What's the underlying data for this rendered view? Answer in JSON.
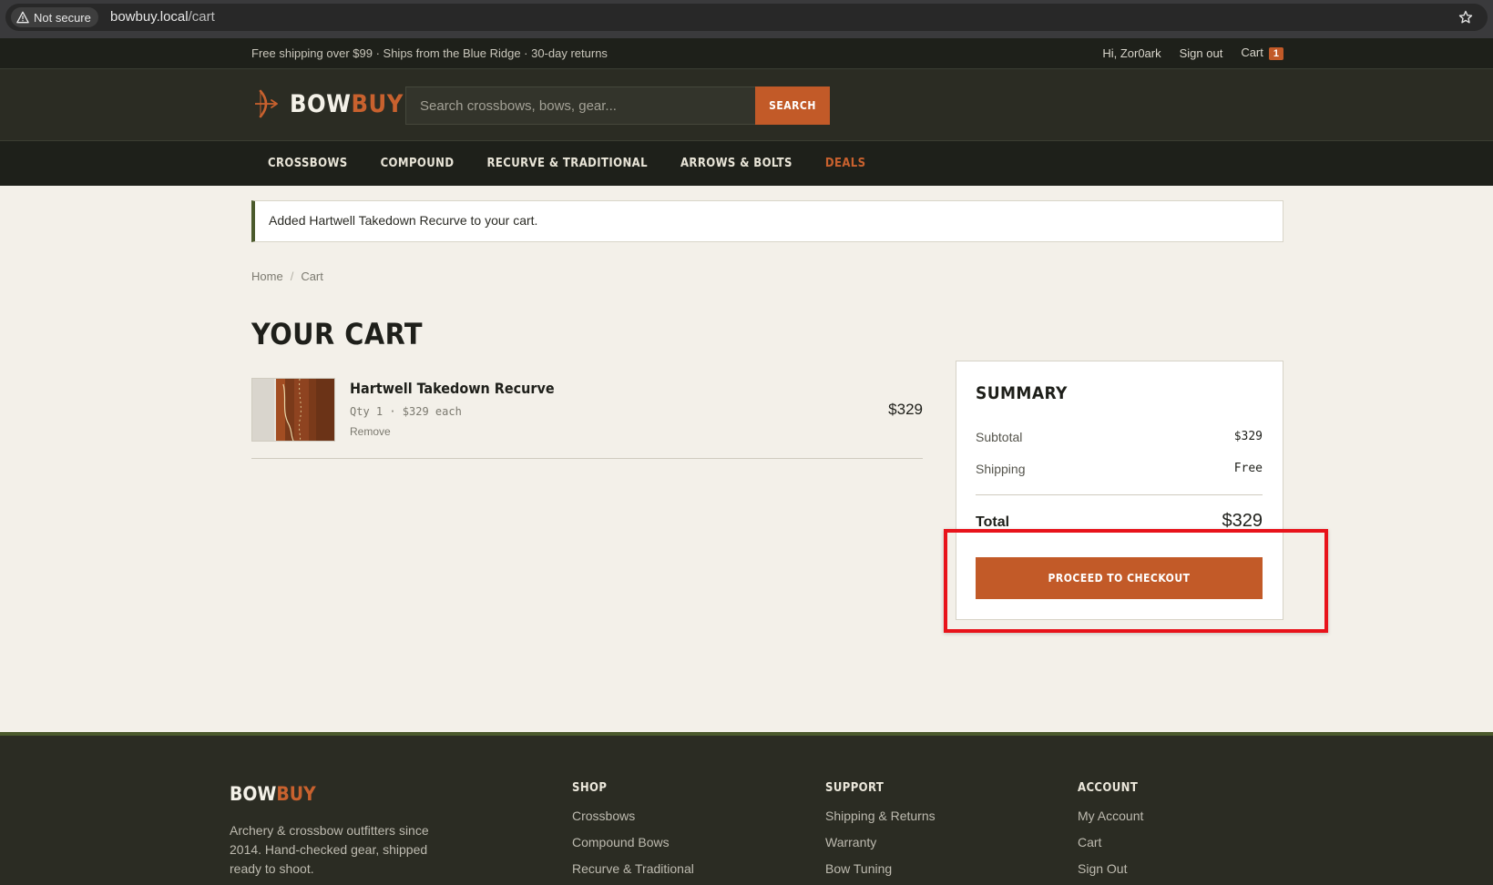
{
  "browser": {
    "security_label": "Not secure",
    "url_host": "bowbuy.local",
    "url_path": "/cart"
  },
  "topbar": {
    "promo": "Free shipping over $99 · Ships from the Blue Ridge · 30-day returns",
    "greeting": "Hi, Zor0ark",
    "sign_out": "Sign out",
    "cart_label": "Cart",
    "cart_count": "1"
  },
  "header": {
    "logo_part1": "BOW",
    "logo_part2": "BUY",
    "search_placeholder": "Search crossbows, bows, gear...",
    "search_button": "SEARCH"
  },
  "nav": {
    "items": [
      "CROSSBOWS",
      "COMPOUND",
      "RECURVE & TRADITIONAL",
      "ARROWS & BOLTS",
      "DEALS"
    ]
  },
  "flash": "Added Hartwell Takedown Recurve to your cart.",
  "breadcrumb": {
    "home": "Home",
    "sep": "/",
    "current": "Cart"
  },
  "page_title": "YOUR CART",
  "cart_items": [
    {
      "name": "Hartwell Takedown Recurve",
      "meta": "Qty 1 · $329 each",
      "remove": "Remove",
      "price": "$329"
    }
  ],
  "summary": {
    "title": "SUMMARY",
    "subtitle_label": "Subtotal",
    "subtotal": "$329",
    "shipping_label": "Shipping",
    "shipping": "Free",
    "total_label": "Total",
    "total": "$329",
    "checkout_button": "PROCEED TO CHECKOUT"
  },
  "footer": {
    "logo_part1": "BOW",
    "logo_part2": "BUY",
    "description": "Archery & crossbow outfitters since 2014. Hand-checked gear, shipped ready to shoot.",
    "shop": {
      "heading": "SHOP",
      "links": [
        "Crossbows",
        "Compound Bows",
        "Recurve & Traditional"
      ]
    },
    "support": {
      "heading": "SUPPORT",
      "links": [
        "Shipping & Returns",
        "Warranty",
        "Bow Tuning"
      ]
    },
    "account": {
      "heading": "ACCOUNT",
      "links": [
        "My Account",
        "Cart",
        "Sign Out"
      ]
    }
  },
  "colors": {
    "accent": "#c25a28",
    "highlight": "#e8131b",
    "dark": "#1e201a",
    "cream": "#f3f0e9"
  }
}
